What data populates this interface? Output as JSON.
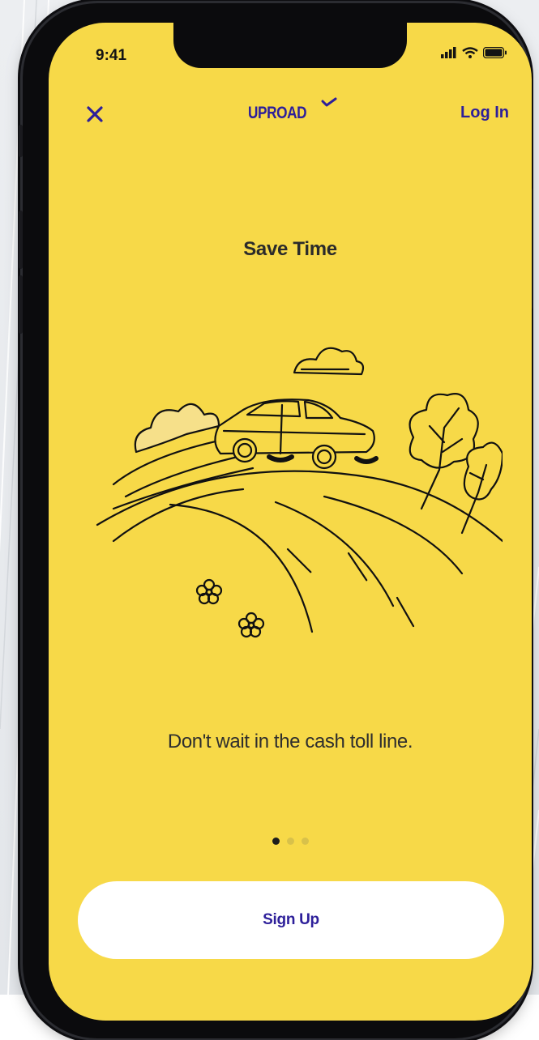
{
  "status_bar": {
    "time": "9:41"
  },
  "header": {
    "close_icon": "close-icon",
    "logo_text": "UPROAD",
    "login_label": "Log In"
  },
  "content": {
    "title": "Save Time",
    "illustration": "car-on-hill-illustration",
    "subtitle": "Don't wait in the cash toll line."
  },
  "pager": {
    "pages": 3,
    "active_index": 0
  },
  "footer": {
    "signup_label": "Sign Up"
  },
  "colors": {
    "screen_bg": "#f7d948",
    "brand": "#2d1f9a",
    "button_bg": "#ffffff"
  }
}
